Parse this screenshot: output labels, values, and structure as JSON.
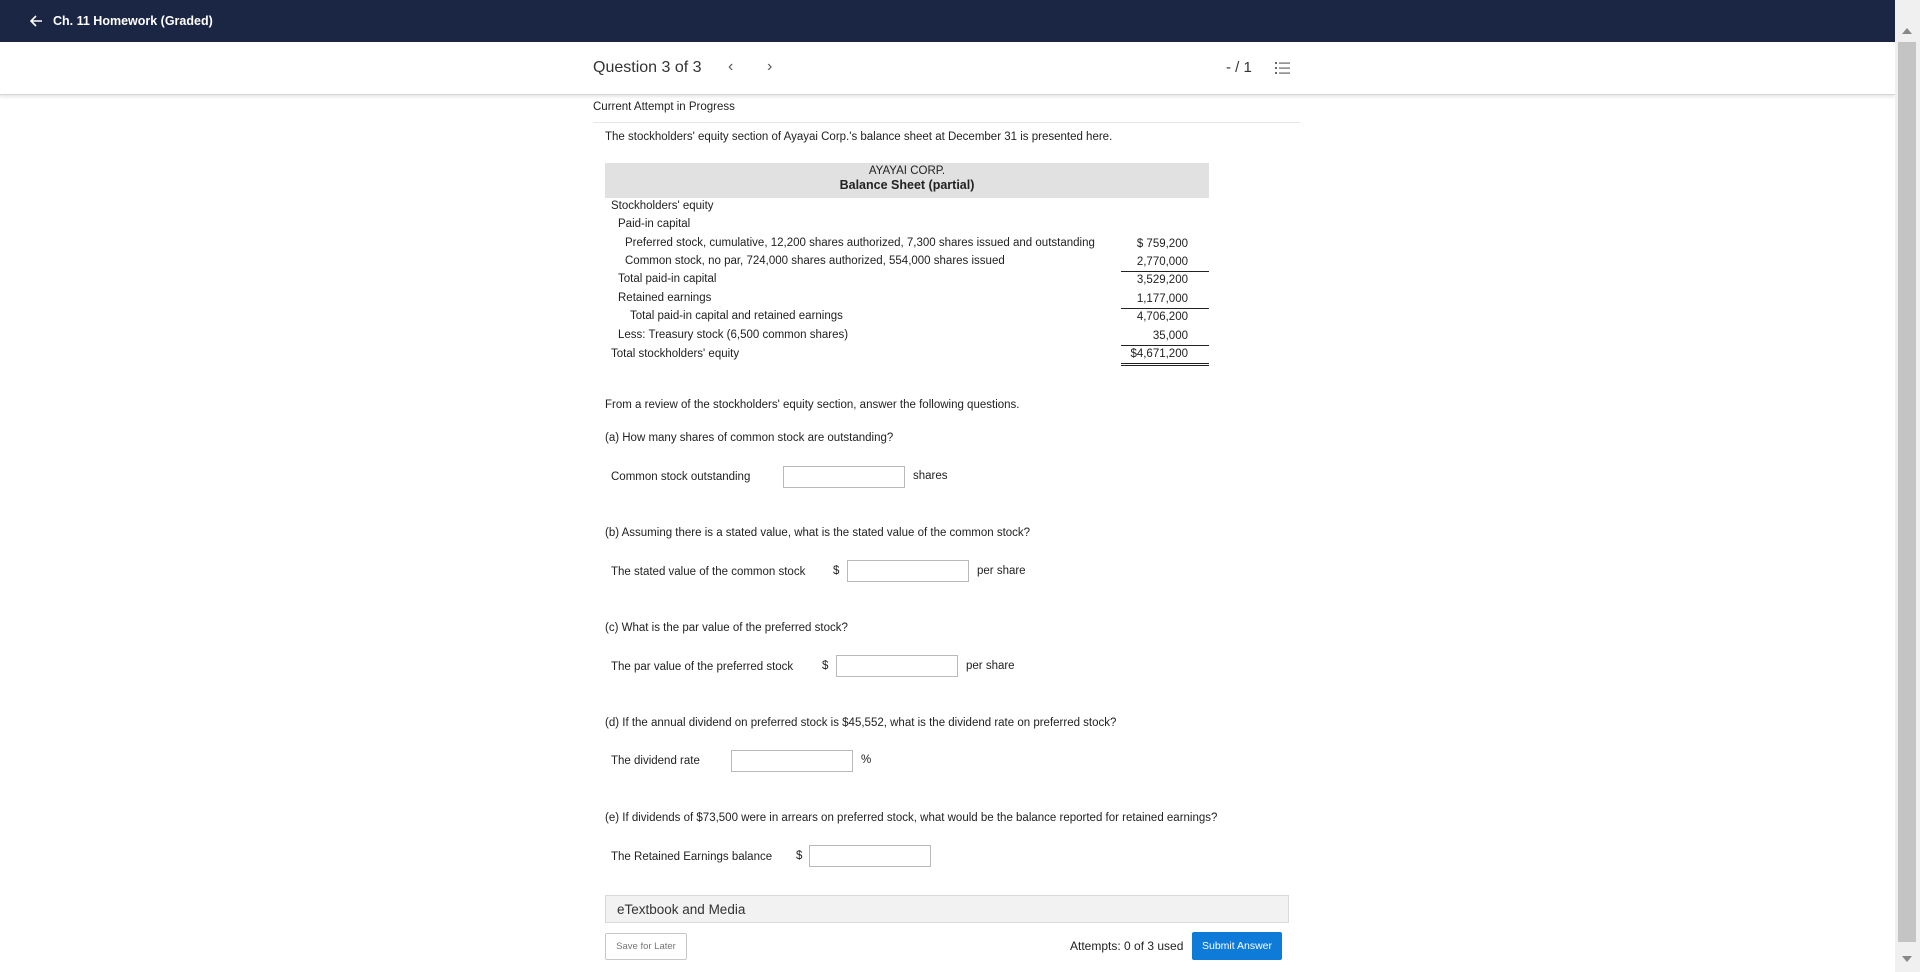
{
  "topbar": {
    "back_icon": "arrow-left-icon",
    "title": "Ch. 11 Homework (Graded)"
  },
  "header": {
    "question_label": "Question 3 of 3",
    "prev_glyph": "‹",
    "next_glyph": "›",
    "score": "- / 1",
    "list_icon": "numbered-list-icon"
  },
  "attempt_heading": "Current Attempt in Progress",
  "intro": "The stockholders' equity section of Ayayai Corp.'s balance sheet at December 31 is presented here.",
  "balance_sheet": {
    "company": "AYAYAI CORP.",
    "title": "Balance Sheet (partial)",
    "rows": [
      {
        "label": "Stockholders' equity",
        "amount": ""
      },
      {
        "label": "Paid-in capital",
        "amount": ""
      },
      {
        "label": "Preferred stock, cumulative, 12,200 shares authorized, 7,300 shares issued and outstanding",
        "amount": "$ 759,200"
      },
      {
        "label": "Common stock, no par, 724,000 shares authorized, 554,000 shares issued",
        "amount": "2,770,000"
      },
      {
        "label": "Total paid-in capital",
        "amount": "3,529,200"
      },
      {
        "label": "Retained earnings",
        "amount": "1,177,000"
      },
      {
        "label": "Total paid-in capital and retained earnings",
        "amount": "4,706,200"
      },
      {
        "label": "Less: Treasury stock (6,500 common shares)",
        "amount": "35,000"
      },
      {
        "label": "Total stockholders' equity",
        "amount": "$4,671,200"
      }
    ]
  },
  "review_text": "From a review of the stockholders' equity section, answer the following questions.",
  "questions": {
    "a": {
      "text": "(a) How many shares of common stock are outstanding?",
      "label": "Common stock outstanding",
      "value": "",
      "unit": "shares"
    },
    "b": {
      "text": "(b) Assuming there is a stated value, what is the stated value of the common stock?",
      "label": "The stated value of the common stock",
      "prefix": "$",
      "value": "",
      "unit": "per share"
    },
    "c": {
      "text": "(c) What is the par value of the preferred stock?",
      "label": "The par value of the preferred stock",
      "prefix": "$",
      "value": "",
      "unit": "per share"
    },
    "d": {
      "text": "(d) If the annual dividend on preferred stock is $45,552, what is the dividend rate on preferred stock?",
      "label": "The dividend rate",
      "value": "",
      "unit": "%"
    },
    "e": {
      "text": "(e) If dividends of $73,500 were in arrears on preferred stock, what would be the balance reported for retained earnings?",
      "label": "The Retained Earnings balance",
      "prefix": "$",
      "value": ""
    }
  },
  "etextbook_label": "eTextbook and Media",
  "footer": {
    "save_label": "Save for Later",
    "attempts": "Attempts: 0 of 3 used",
    "submit_label": "Submit Answer"
  },
  "colors": {
    "topbar": "#1b2544",
    "submit": "#0e7bd8",
    "table_header": "#e1e1e1"
  }
}
